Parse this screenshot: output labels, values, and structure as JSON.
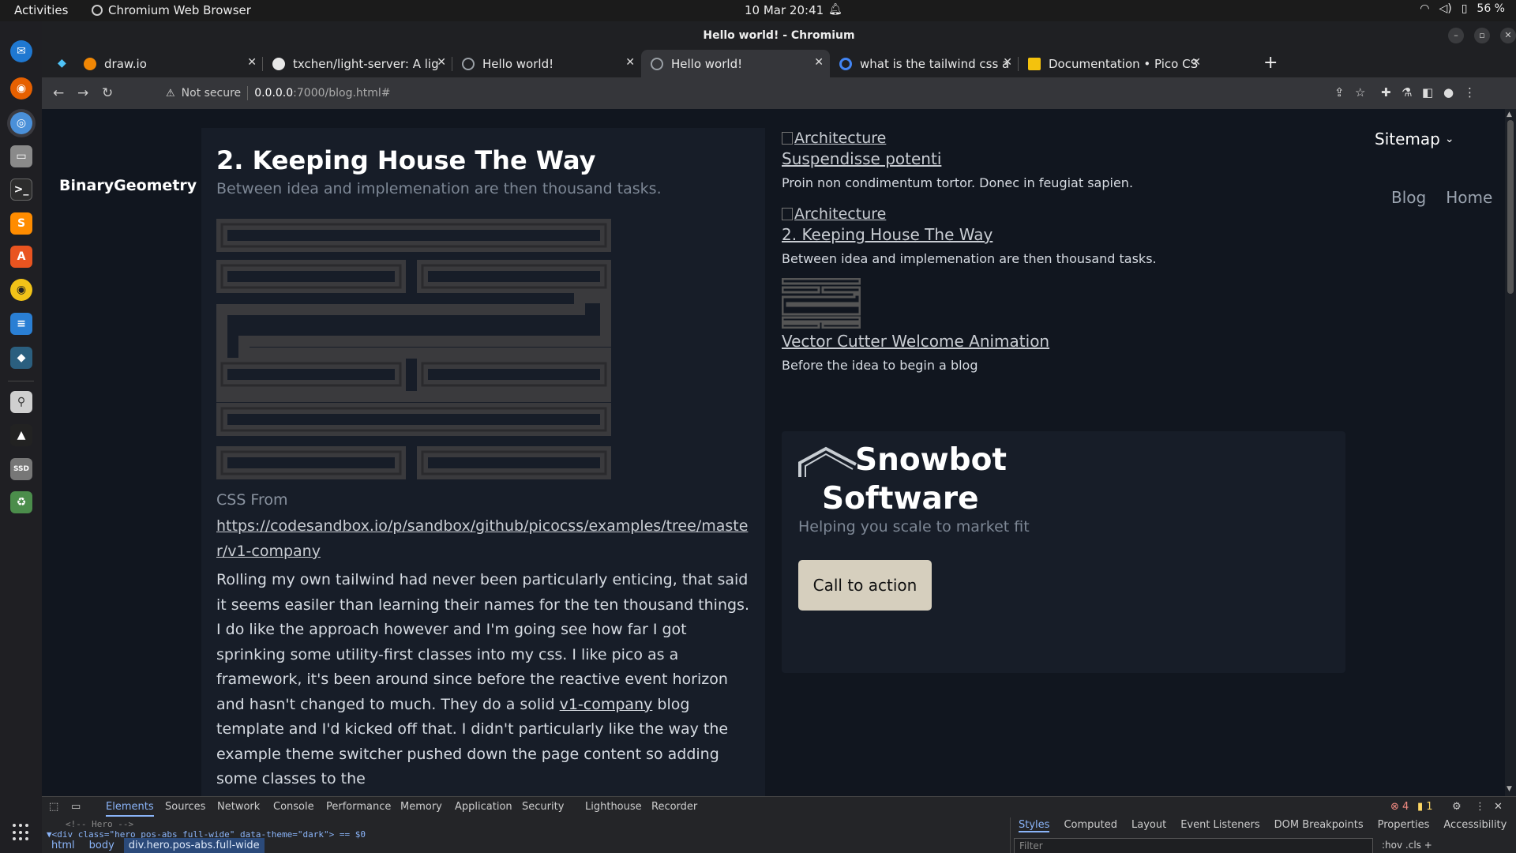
{
  "system": {
    "activities": "Activities",
    "app_name": "Chromium Web Browser",
    "clock": "10 Mar  20:41",
    "battery": "56 %"
  },
  "window": {
    "title": "Hello world! - Chromium"
  },
  "tabs": [
    {
      "title": "draw.io",
      "favicon_color": "#f08705"
    },
    {
      "title": "txchen/light-server: A lig",
      "favicon_color": "#e8e8e8"
    },
    {
      "title": "Hello world!",
      "favicon_color": "#9aa0a6"
    },
    {
      "title": "Hello world!",
      "favicon_color": "#9aa0a6"
    },
    {
      "title": "what is the tailwind css a",
      "favicon_color": "#4285f4"
    },
    {
      "title": "Documentation • Pico CS",
      "favicon_color": "#f4c20d"
    }
  ],
  "address": {
    "security": "Not secure",
    "host": "0.0.0.0",
    "path": ":7000/blog.html#"
  },
  "page": {
    "brand": "BinaryGeometry",
    "article": {
      "title": "2. Keeping House The Way",
      "subtitle": "Between idea and implemenation are then thousand tasks.",
      "css_from": "CSS From",
      "css_link": "https://codesandbox.io/p/sandbox/github/picocss/examples/tree/master/v1-company",
      "body_before": "Rolling my own tailwind had never been particularly enticing, that said it seems easiler than learning their names for the ten thousand things. I do like the approach however and I'm going see how far I got sprinking some utility-first classes into my css. I like pico as a framework, it's been around since before the reactive event horizon and hasn't changed to much. They do a solid ",
      "body_link": "v1-company",
      "body_after": " blog template and I'd kicked off that. I didn't particularly like the way the example theme switcher pushed down the page content so adding some classes to the"
    },
    "cards": [
      {
        "image_alt": "Architecture",
        "title": "Suspendisse potenti",
        "desc": "Proin non condimentum tortor. Donec in feugiat sapien."
      },
      {
        "image_alt": "Architecture",
        "title": "2. Keeping House The Way",
        "desc": "Between idea and implemenation are then thousand tasks."
      },
      {
        "image_alt": "",
        "title": "Vector Cutter Welcome Animation",
        "desc": "Before the idea to begin a blog"
      }
    ],
    "hero": {
      "title_line1": "Snowbot",
      "title_line2": "Software",
      "tagline": "Helping you scale to market fit",
      "cta": "Call to action"
    },
    "nav": {
      "sitemap": "Sitemap",
      "blog": "Blog",
      "home": "Home"
    }
  },
  "devtools": {
    "tabs": [
      "Elements",
      "Sources",
      "Network",
      "Console",
      "Performance",
      "Memory",
      "Application",
      "Security",
      "Lighthouse",
      "Recorder"
    ],
    "errors": "4",
    "warnings": "1",
    "code_line1": "<!-- Hero -->",
    "code_line2": "▼<div class=\"hero pos-abs full-wide\" data-theme=\"dark\"> == $0",
    "crumbs": [
      "html",
      "body",
      "div.hero.pos-abs.full-wide"
    ],
    "style_tabs": [
      "Styles",
      "Computed",
      "Layout",
      "Event Listeners",
      "DOM Breakpoints",
      "Properties",
      "Accessibility"
    ],
    "filter_placeholder": "Filter",
    "hov": ":hov  .cls  +"
  }
}
